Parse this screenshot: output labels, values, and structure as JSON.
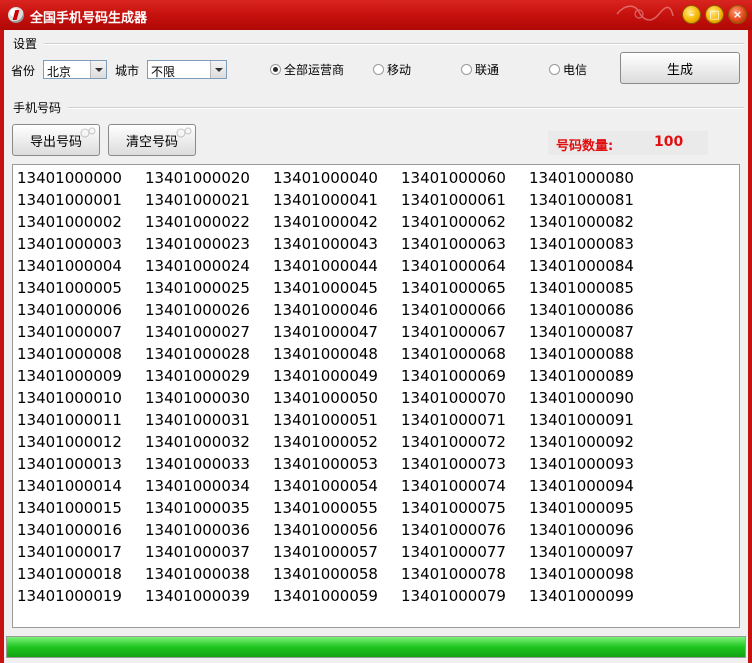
{
  "window": {
    "title": "全国手机号码生成器"
  },
  "settings": {
    "group_label": "设置",
    "province_label": "省份",
    "province_value": "北京",
    "city_label": "城市",
    "city_value": "不限",
    "carriers": [
      {
        "label": "全部运营商",
        "selected": true
      },
      {
        "label": "移动",
        "selected": false
      },
      {
        "label": "联通",
        "selected": false
      },
      {
        "label": "电信",
        "selected": false
      }
    ],
    "generate_label": "生成"
  },
  "numbers": {
    "group_label": "手机号码",
    "export_label": "导出号码",
    "clear_label": "清空号码",
    "count_label": "号码数量:",
    "count_value": "100",
    "columns": [
      [
        "13401000000",
        "13401000001",
        "13401000002",
        "13401000003",
        "13401000004",
        "13401000005",
        "13401000006",
        "13401000007",
        "13401000008",
        "13401000009",
        "13401000010",
        "13401000011",
        "13401000012",
        "13401000013",
        "13401000014",
        "13401000015",
        "13401000016",
        "13401000017",
        "13401000018",
        "13401000019"
      ],
      [
        "13401000020",
        "13401000021",
        "13401000022",
        "13401000023",
        "13401000024",
        "13401000025",
        "13401000026",
        "13401000027",
        "13401000028",
        "13401000029",
        "13401000030",
        "13401000031",
        "13401000032",
        "13401000033",
        "13401000034",
        "13401000035",
        "13401000036",
        "13401000037",
        "13401000038",
        "13401000039"
      ],
      [
        "13401000040",
        "13401000041",
        "13401000042",
        "13401000043",
        "13401000044",
        "13401000045",
        "13401000046",
        "13401000047",
        "13401000048",
        "13401000049",
        "13401000050",
        "13401000051",
        "13401000052",
        "13401000053",
        "13401000054",
        "13401000055",
        "13401000056",
        "13401000057",
        "13401000058",
        "13401000059"
      ],
      [
        "13401000060",
        "13401000061",
        "13401000062",
        "13401000063",
        "13401000064",
        "13401000065",
        "13401000066",
        "13401000067",
        "13401000068",
        "13401000069",
        "13401000070",
        "13401000071",
        "13401000072",
        "13401000073",
        "13401000074",
        "13401000075",
        "13401000076",
        "13401000077",
        "13401000078",
        "13401000079"
      ],
      [
        "13401000080",
        "13401000081",
        "13401000082",
        "13401000083",
        "13401000084",
        "13401000085",
        "13401000086",
        "13401000087",
        "13401000088",
        "13401000089",
        "13401000090",
        "13401000091",
        "13401000092",
        "13401000093",
        "13401000094",
        "13401000095",
        "13401000096",
        "13401000097",
        "13401000098",
        "13401000099"
      ]
    ]
  },
  "progress": {
    "percent": 100
  },
  "colors": {
    "titlebar": "#c8120f",
    "count_text": "#e01010",
    "progress": "#1fc51f"
  }
}
